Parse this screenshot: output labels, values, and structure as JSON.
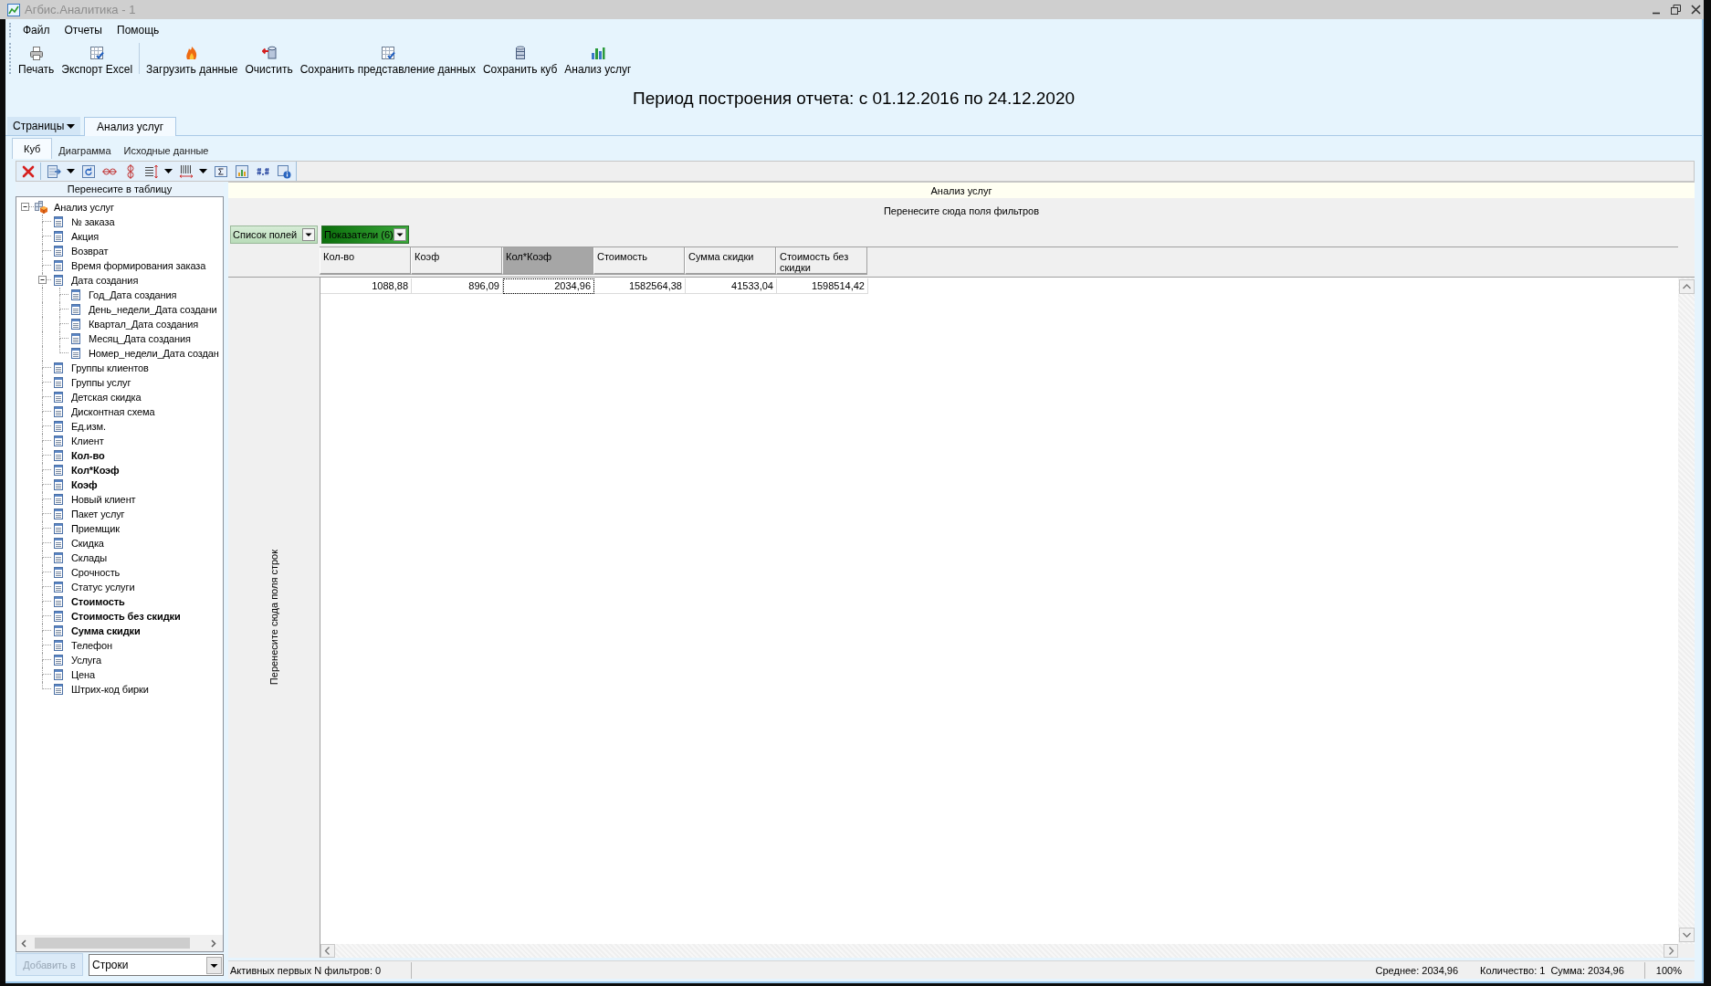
{
  "window": {
    "title": "Агбис.Аналитика - 1"
  },
  "menu": [
    "Файл",
    "Отчеты",
    "Помощь"
  ],
  "toolbar": [
    [
      {
        "label": "Печать",
        "kind": "print"
      },
      {
        "label": "Экспорт Excel",
        "kind": "excel"
      }
    ],
    [
      {
        "label": "Загрузить данные",
        "kind": "load"
      },
      {
        "label": "Очистить",
        "kind": "clear"
      },
      {
        "label": "Сохранить представление данных",
        "kind": "view"
      },
      {
        "label": "Сохранить куб",
        "kind": "cube"
      },
      {
        "label": "Анализ услуг",
        "kind": "chart"
      }
    ]
  ],
  "report_period": "Период построения отчета: с 01.12.2016 по 24.12.2020",
  "page_tabs": {
    "menu_label": "Страницы",
    "tabs": [
      {
        "label": "Анализ услуг",
        "selected": true
      }
    ]
  },
  "view_tabs": [
    {
      "label": "Куб",
      "selected": true
    },
    {
      "label": "Диаграмма",
      "selected": false
    },
    {
      "label": "Исходные данные",
      "selected": false
    }
  ],
  "field_list": {
    "header": "Перенесите в таблицу",
    "tree": [
      {
        "label": "Анализ услуг",
        "measure": false,
        "expanded": true,
        "children": [
          {
            "label": "№ заказа",
            "measure": false
          },
          {
            "label": "Акция",
            "measure": false
          },
          {
            "label": "Возврат",
            "measure": false
          },
          {
            "label": "Время формирования заказа",
            "measure": false
          },
          {
            "label": "Дата создания",
            "measure": false,
            "expanded": true,
            "children": [
              {
                "label": "Год_Дата создания",
                "measure": false
              },
              {
                "label": "День_недели_Дата создани",
                "measure": false
              },
              {
                "label": "Квартал_Дата создания",
                "measure": false
              },
              {
                "label": "Месяц_Дата создания",
                "measure": false
              },
              {
                "label": "Номер_недели_Дата создан",
                "measure": false
              }
            ]
          },
          {
            "label": "Группы клиентов",
            "measure": false
          },
          {
            "label": "Группы услуг",
            "measure": false
          },
          {
            "label": "Детская скидка",
            "measure": false
          },
          {
            "label": "Дисконтная схема",
            "measure": false
          },
          {
            "label": "Ед.изм.",
            "measure": false
          },
          {
            "label": "Клиент",
            "measure": false
          },
          {
            "label": "Кол-во",
            "measure": true
          },
          {
            "label": "Кол*Коэф",
            "measure": true
          },
          {
            "label": "Коэф",
            "measure": true
          },
          {
            "label": "Новый клиент",
            "measure": false
          },
          {
            "label": "Пакет услуг",
            "measure": false
          },
          {
            "label": "Приемщик",
            "measure": false
          },
          {
            "label": "Скидка",
            "measure": false
          },
          {
            "label": "Склады",
            "measure": false
          },
          {
            "label": "Срочность",
            "measure": false
          },
          {
            "label": "Статус услуги",
            "measure": false
          },
          {
            "label": "Стоимость",
            "measure": true
          },
          {
            "label": "Стоимость без скидки",
            "measure": true
          },
          {
            "label": "Сумма скидки",
            "measure": true
          },
          {
            "label": "Телефон",
            "measure": false
          },
          {
            "label": "Услуга",
            "measure": false
          },
          {
            "label": "Цена",
            "measure": false
          },
          {
            "label": "Штрих-код бирки",
            "measure": false
          }
        ]
      }
    ],
    "add_button": {
      "label": "Добавить в",
      "disabled": true
    },
    "target": {
      "value": "Строки"
    }
  },
  "pivot": {
    "title": "Анализ услуг",
    "filter_hint": "Перенесите сюда поля фильтров",
    "field_buttons": [
      {
        "label": "Список полей",
        "kind": "list"
      },
      {
        "label": "Показатели (6)",
        "kind": "measures"
      }
    ],
    "row_hint": "Перенесите сюда поля строк",
    "columns": [
      {
        "label": "Кол-во",
        "selected": false
      },
      {
        "label": "Коэф",
        "selected": false
      },
      {
        "label": "Кол*Коэф",
        "selected": true
      },
      {
        "label": "Стоимость",
        "selected": false
      },
      {
        "label": "Сумма скидки",
        "selected": false
      },
      {
        "label": "Стоимость без скидки",
        "selected": false
      }
    ],
    "rows": [
      {
        "cells": [
          {
            "value": "1088,88",
            "selected": false
          },
          {
            "value": "896,09",
            "selected": false
          },
          {
            "value": "2034,96",
            "selected": true
          },
          {
            "value": "1582564,38",
            "selected": false
          },
          {
            "value": "41533,04",
            "selected": false
          },
          {
            "value": "1598514,42",
            "selected": false
          }
        ]
      }
    ]
  },
  "status_bar": {
    "filters": "Активных первых N фильтров: 0",
    "average": "Среднее: 2034,96",
    "count": "Количество: 1",
    "sum": "Сумма: 2034,96",
    "zoom": "100%"
  }
}
